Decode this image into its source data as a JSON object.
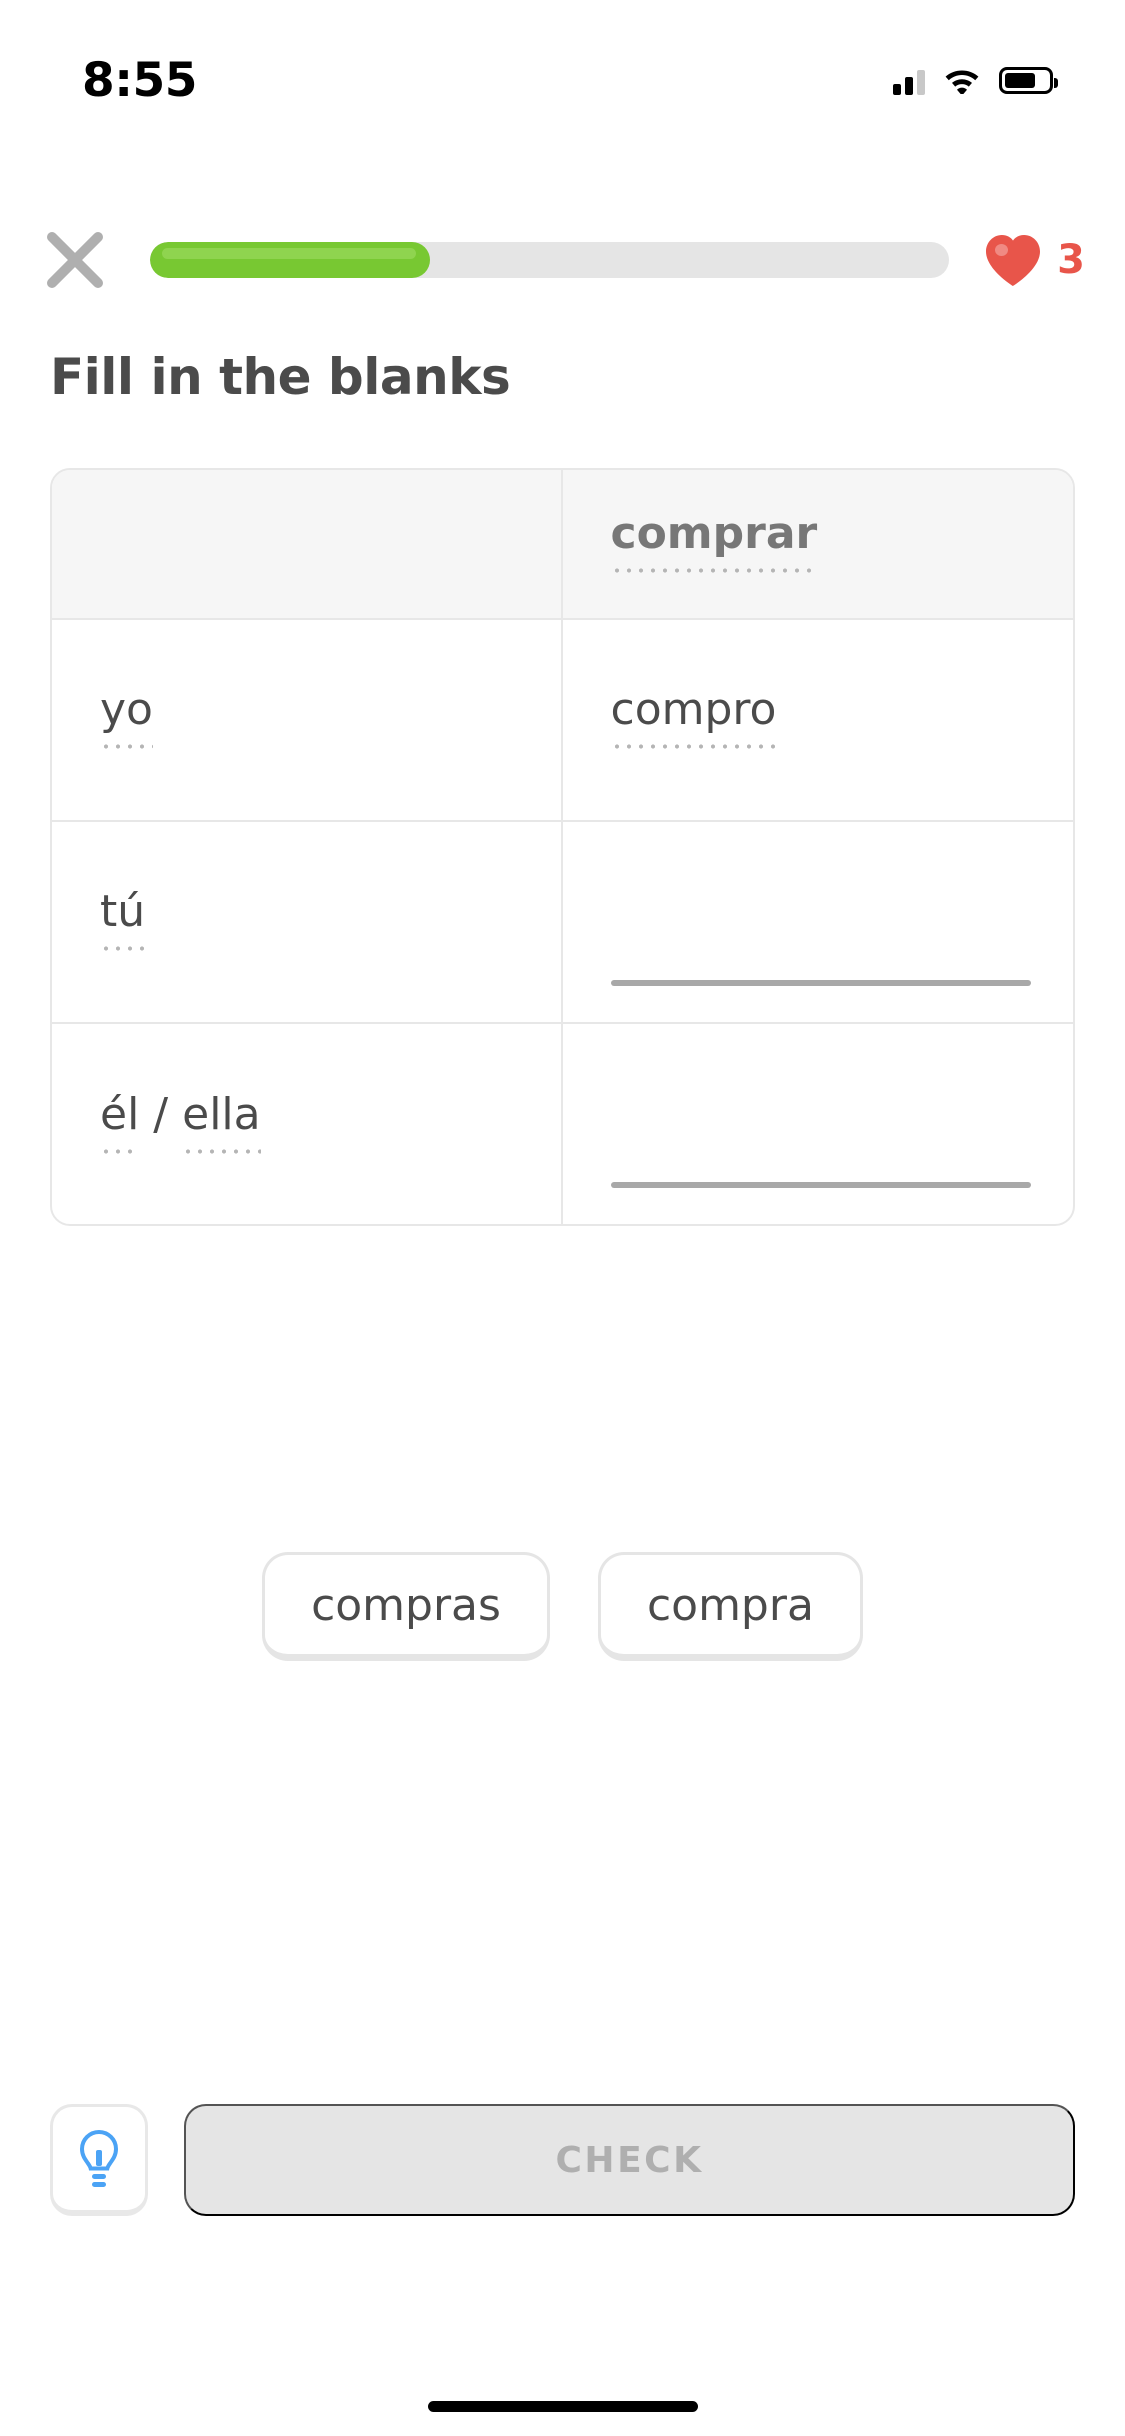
{
  "status_bar": {
    "time": "8:55",
    "cellular_icon": "cellular-signal-icon",
    "cellular_bars_filled": 2,
    "cellular_bars_total": 3,
    "wifi_icon": "wifi-icon",
    "battery_icon": "battery-icon",
    "battery_percent": 72
  },
  "header": {
    "close_icon": "close-x-icon",
    "progress_percent": 35,
    "progress_fill_color": "#78c832",
    "progress_track_color": "#e5e5e5",
    "heart_icon": "heart-icon",
    "heart_color": "#e8554a",
    "hearts_count": "3"
  },
  "exercise": {
    "title": "Fill in the blanks",
    "table": {
      "header": {
        "left": {
          "text": "",
          "dotted": false
        },
        "right": {
          "text": "comprar",
          "dotted": true
        }
      },
      "rows": [
        {
          "left_words": [
            {
              "text": "yo",
              "dotted": true
            }
          ],
          "right": {
            "text": "compro",
            "dotted": true,
            "blank": false
          }
        },
        {
          "left_words": [
            {
              "text": "tú",
              "dotted": true
            }
          ],
          "right": {
            "text": "",
            "dotted": false,
            "blank": true
          }
        },
        {
          "left_words": [
            {
              "text": "él",
              "dotted": true
            },
            {
              "text": "/",
              "separator": true
            },
            {
              "text": "ella",
              "dotted": true
            }
          ],
          "right": {
            "text": "",
            "dotted": false,
            "blank": true
          }
        }
      ]
    },
    "options": [
      {
        "label": "compras"
      },
      {
        "label": "compra"
      }
    ]
  },
  "footer": {
    "hint_icon": "lightbulb-icon",
    "hint_icon_color": "#4ba3f5",
    "check_label": "CHECK",
    "check_enabled": false
  }
}
